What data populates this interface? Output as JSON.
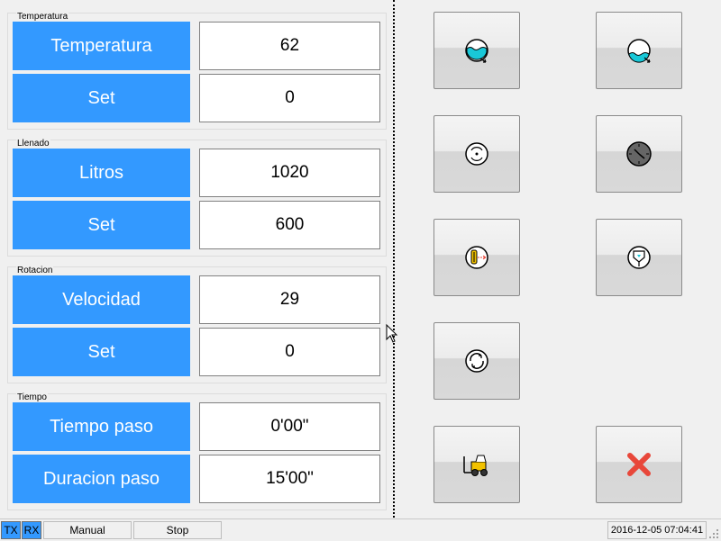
{
  "groups": [
    {
      "title": "Temperatura",
      "rows": [
        {
          "label": "Temperatura",
          "value": "62"
        },
        {
          "label": "Set",
          "value": "0"
        }
      ]
    },
    {
      "title": "Llenado",
      "rows": [
        {
          "label": "Litros",
          "value": "1020"
        },
        {
          "label": "Set",
          "value": "600"
        }
      ]
    },
    {
      "title": "Rotacion",
      "rows": [
        {
          "label": "Velocidad",
          "value": "29"
        },
        {
          "label": "Set",
          "value": "0"
        }
      ]
    },
    {
      "title": "Tiempo",
      "rows": [
        {
          "label": "Tiempo paso",
          "value": "0'00\""
        },
        {
          "label": "Duracion paso",
          "value": "15'00\""
        }
      ]
    }
  ],
  "buttons": [
    {
      "icon": "water-fill-icon"
    },
    {
      "icon": "water-drain-icon"
    },
    {
      "icon": "rotation-icon"
    },
    {
      "icon": "clock-icon"
    },
    {
      "icon": "heater-icon"
    },
    {
      "icon": "dispenser-icon"
    },
    {
      "icon": "spin-icon"
    },
    {
      "icon": "forklift-icon"
    },
    {
      "icon": "close-icon"
    }
  ],
  "statusbar": {
    "tx": "TX",
    "rx": "RX",
    "mode": "Manual",
    "state": "Stop",
    "datetime": "2016-12-05 07:04:41"
  },
  "colors": {
    "accent": "#3399ff",
    "water": "#19c8d8",
    "close": "#e8473a",
    "forklift": "#f2c200"
  }
}
